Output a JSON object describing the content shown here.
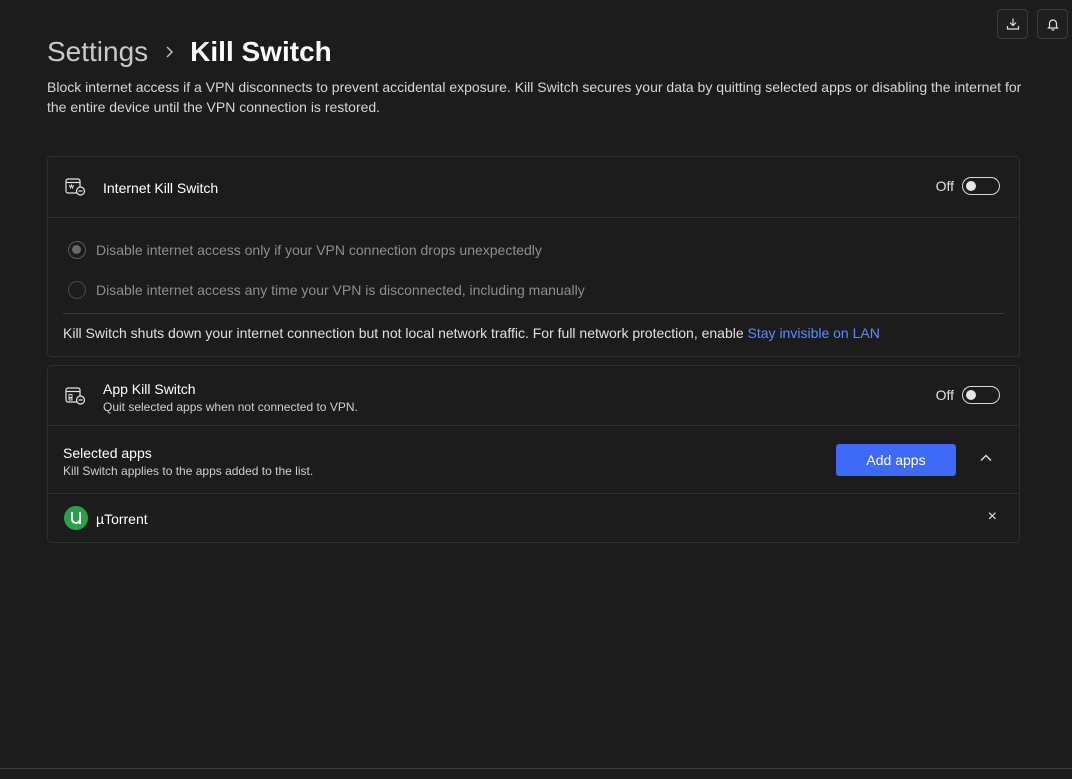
{
  "header": {
    "breadcrumb_parent": "Settings",
    "breadcrumb_current": "Kill Switch",
    "description": "Block internet access if a VPN disconnects to prevent accidental exposure. Kill Switch secures your data by quitting selected apps or disabling the internet for the entire device until the VPN connection is restored."
  },
  "top_icons": [
    "download-icon",
    "bell-icon"
  ],
  "internet_kill_switch": {
    "title": "Internet Kill Switch",
    "toggle_label": "Off",
    "toggle_on": false,
    "options": [
      {
        "label": "Disable internet access only if your VPN connection drops unexpectedly",
        "selected": true
      },
      {
        "label": "Disable internet access any time your VPN is disconnected, including manually",
        "selected": false
      }
    ],
    "note_text": "Kill Switch shuts down your internet connection but not local network traffic. For full network protection, enable ",
    "note_link": "Stay invisible on LAN"
  },
  "app_kill_switch": {
    "title": "App Kill Switch",
    "subtitle": "Quit selected apps when not connected to VPN.",
    "toggle_label": "Off",
    "toggle_on": false,
    "selected_apps_title": "Selected apps",
    "selected_apps_subtitle": "Kill Switch applies to the apps added to the list.",
    "add_apps_label": "Add apps",
    "apps": [
      {
        "name": "µTorrent",
        "icon": "utorrent-icon",
        "remove_label": "×"
      }
    ]
  },
  "colors": {
    "background": "#1c1c1c",
    "accent": "#3e6af7",
    "link": "#5b8cff",
    "app_icon": "#2ba24a"
  }
}
